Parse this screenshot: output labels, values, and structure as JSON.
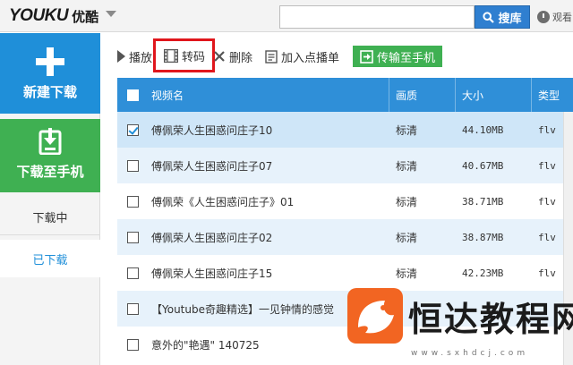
{
  "app": {
    "logo_latin": "YOUKU",
    "logo_cn": "优酷"
  },
  "header": {
    "search_placeholder": "",
    "search_button": "搜库",
    "watch_label": "观看"
  },
  "sidebar": {
    "new_download": "新建下载",
    "download_to_phone": "下载至手机",
    "downloading": "下载中",
    "downloaded": "已下载"
  },
  "toolbar": {
    "play": "播放",
    "convert": "转码",
    "delete": "删除",
    "add_to_playlist": "加入点播单",
    "transfer_to_phone": "传输至手机"
  },
  "table": {
    "columns": [
      "视频名",
      "画质",
      "大小",
      "类型"
    ],
    "rows": [
      {
        "checked": true,
        "name": "傅佩荣人生困惑问庄子10",
        "quality": "标清",
        "size": "44.10MB",
        "type": "flv"
      },
      {
        "checked": false,
        "name": "傅佩荣人生困惑问庄子07",
        "quality": "标清",
        "size": "40.67MB",
        "type": "flv"
      },
      {
        "checked": false,
        "name": "傅佩荣《人生困惑问庄子》01",
        "quality": "标清",
        "size": "38.71MB",
        "type": "flv"
      },
      {
        "checked": false,
        "name": "傅佩荣人生困惑问庄子02",
        "quality": "标清",
        "size": "38.87MB",
        "type": "flv"
      },
      {
        "checked": false,
        "name": "傅佩荣人生困惑问庄子15",
        "quality": "标清",
        "size": "42.23MB",
        "type": "flv"
      },
      {
        "checked": false,
        "name": "【Youtube奇趣精选】一见钟情的感觉",
        "quality": "",
        "size": "",
        "type": ""
      },
      {
        "checked": false,
        "name": "意外的\"艳遇\" 140725",
        "quality": "",
        "size": "",
        "type": ""
      }
    ]
  },
  "watermark": {
    "text": "恒达教程网",
    "url": "www.sxhdcj.com"
  },
  "colors": {
    "accent_blue": "#1f8fd9",
    "header_blue": "#2f8fd8",
    "green": "#3fb052",
    "highlight_red": "#e0161c"
  }
}
